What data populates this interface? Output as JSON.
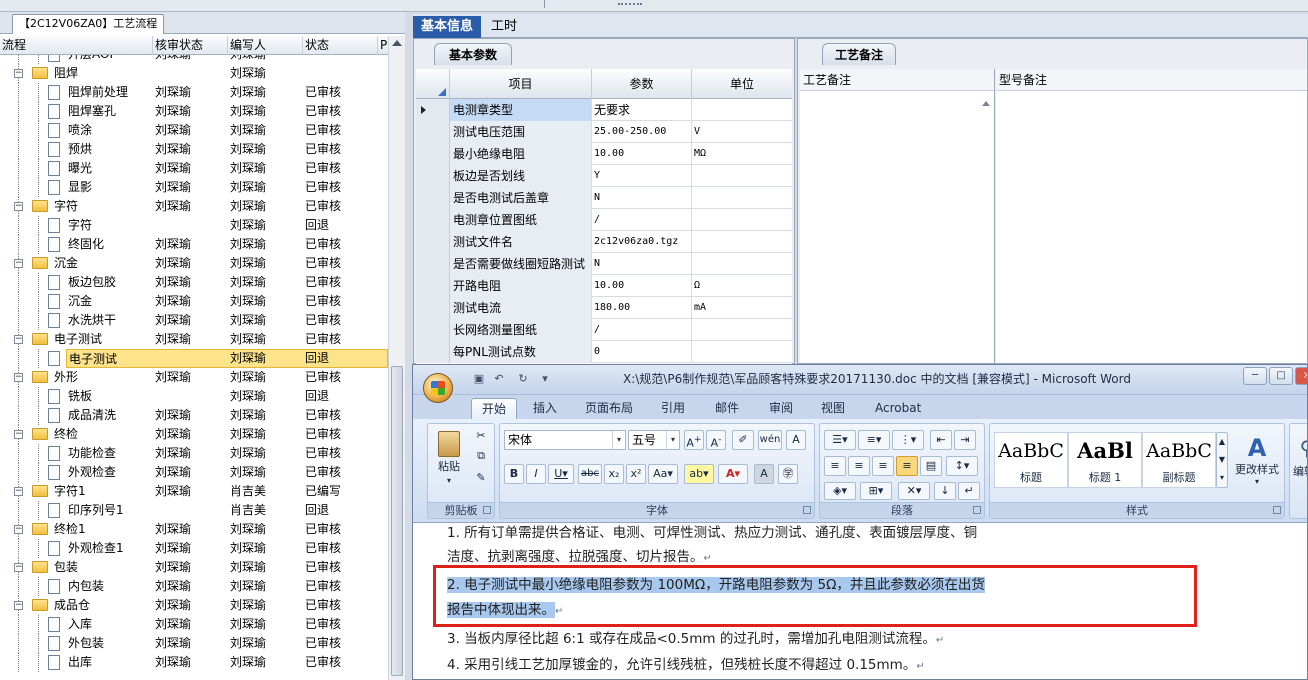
{
  "left_panel": {
    "tab": "【2C12V06ZA0】工艺流程",
    "columns": [
      "流程",
      "核审状态",
      "编写人",
      "状态",
      "P"
    ],
    "rows": [
      {
        "level": 2,
        "type": "doc",
        "name": "开层AOI",
        "c1": "刘琛瑜",
        "c2": "刘琛瑜",
        "c3": ""
      },
      {
        "level": 1,
        "type": "folder",
        "name": "阻焊",
        "c1": "",
        "c2": "刘琛瑜",
        "c3": ""
      },
      {
        "level": 2,
        "type": "doc",
        "name": "阻焊前处理",
        "c1": "刘琛瑜",
        "c2": "刘琛瑜",
        "c3": "已审核"
      },
      {
        "level": 2,
        "type": "doc",
        "name": "阻焊塞孔",
        "c1": "刘琛瑜",
        "c2": "刘琛瑜",
        "c3": "已审核"
      },
      {
        "level": 2,
        "type": "doc",
        "name": "喷涂",
        "c1": "刘琛瑜",
        "c2": "刘琛瑜",
        "c3": "已审核"
      },
      {
        "level": 2,
        "type": "doc",
        "name": "预烘",
        "c1": "刘琛瑜",
        "c2": "刘琛瑜",
        "c3": "已审核"
      },
      {
        "level": 2,
        "type": "doc",
        "name": "曝光",
        "c1": "刘琛瑜",
        "c2": "刘琛瑜",
        "c3": "已审核"
      },
      {
        "level": 2,
        "type": "doc",
        "name": "显影",
        "c1": "刘琛瑜",
        "c2": "刘琛瑜",
        "c3": "已审核"
      },
      {
        "level": 1,
        "type": "folder",
        "name": "字符",
        "c1": "刘琛瑜",
        "c2": "刘琛瑜",
        "c3": "已审核"
      },
      {
        "level": 2,
        "type": "doc",
        "name": "字符",
        "c1": "",
        "c2": "刘琛瑜",
        "c3": "回退"
      },
      {
        "level": 2,
        "type": "doc",
        "name": "终固化",
        "c1": "刘琛瑜",
        "c2": "刘琛瑜",
        "c3": "已审核"
      },
      {
        "level": 1,
        "type": "folder",
        "name": "沉金",
        "c1": "刘琛瑜",
        "c2": "刘琛瑜",
        "c3": "已审核"
      },
      {
        "level": 2,
        "type": "doc",
        "name": "板边包胶",
        "c1": "刘琛瑜",
        "c2": "刘琛瑜",
        "c3": "已审核"
      },
      {
        "level": 2,
        "type": "doc",
        "name": "沉金",
        "c1": "刘琛瑜",
        "c2": "刘琛瑜",
        "c3": "已审核"
      },
      {
        "level": 2,
        "type": "doc",
        "name": "水洗烘干",
        "c1": "刘琛瑜",
        "c2": "刘琛瑜",
        "c3": "已审核"
      },
      {
        "level": 1,
        "type": "folder",
        "name": "电子测试",
        "c1": "刘琛瑜",
        "c2": "刘琛瑜",
        "c3": "已审核"
      },
      {
        "level": 2,
        "type": "doc",
        "name": "电子测试",
        "c1": "",
        "c2": "刘琛瑜",
        "c3": "回退",
        "selected": true
      },
      {
        "level": 1,
        "type": "folder",
        "name": "外形",
        "c1": "刘琛瑜",
        "c2": "刘琛瑜",
        "c3": "已审核"
      },
      {
        "level": 2,
        "type": "doc",
        "name": "铣板",
        "c1": "",
        "c2": "刘琛瑜",
        "c3": "回退"
      },
      {
        "level": 2,
        "type": "doc",
        "name": "成品清洗",
        "c1": "刘琛瑜",
        "c2": "刘琛瑜",
        "c3": "已审核"
      },
      {
        "level": 1,
        "type": "folder",
        "name": "终检",
        "c1": "刘琛瑜",
        "c2": "刘琛瑜",
        "c3": "已审核"
      },
      {
        "level": 2,
        "type": "doc",
        "name": "功能检查",
        "c1": "刘琛瑜",
        "c2": "刘琛瑜",
        "c3": "已审核"
      },
      {
        "level": 2,
        "type": "doc",
        "name": "外观检查",
        "c1": "刘琛瑜",
        "c2": "刘琛瑜",
        "c3": "已审核"
      },
      {
        "level": 1,
        "type": "folder",
        "name": "字符1",
        "c1": "刘琛瑜",
        "c2": "肖吉美",
        "c3": "已编写"
      },
      {
        "level": 2,
        "type": "doc",
        "name": "印序列号1",
        "c1": "",
        "c2": "肖吉美",
        "c3": "回退"
      },
      {
        "level": 1,
        "type": "folder",
        "name": "终检1",
        "c1": "刘琛瑜",
        "c2": "刘琛瑜",
        "c3": "已审核"
      },
      {
        "level": 2,
        "type": "doc",
        "name": "外观检查1",
        "c1": "刘琛瑜",
        "c2": "刘琛瑜",
        "c3": "已审核"
      },
      {
        "level": 1,
        "type": "folder",
        "name": "包装",
        "c1": "刘琛瑜",
        "c2": "刘琛瑜",
        "c3": "已审核"
      },
      {
        "level": 2,
        "type": "doc",
        "name": "内包装",
        "c1": "刘琛瑜",
        "c2": "刘琛瑜",
        "c3": "已审核"
      },
      {
        "level": 1,
        "type": "folder",
        "name": "成品仓",
        "c1": "刘琛瑜",
        "c2": "刘琛瑜",
        "c3": "已审核"
      },
      {
        "level": 2,
        "type": "doc",
        "name": "入库",
        "c1": "刘琛瑜",
        "c2": "刘琛瑜",
        "c3": "已审核"
      },
      {
        "level": 2,
        "type": "doc",
        "name": "外包装",
        "c1": "刘琛瑜",
        "c2": "刘琛瑜",
        "c3": "已审核"
      },
      {
        "level": 2,
        "type": "doc",
        "name": "出库",
        "c1": "刘琛瑜",
        "c2": "刘琛瑜",
        "c3": "已审核"
      }
    ]
  },
  "main_tabs": [
    "基本信息",
    "工时"
  ],
  "basic_params": {
    "tab": "基本参数",
    "columns": [
      "项目",
      "参数",
      "单位"
    ],
    "rows": [
      {
        "item": "电测章类型",
        "param": "无要求",
        "unit": "",
        "current": true
      },
      {
        "item": "测试电压范围",
        "param": "25.00-250.00",
        "unit": "V"
      },
      {
        "item": "最小绝缘电阻",
        "param": "10.00",
        "unit": "MΩ"
      },
      {
        "item": "板边是否划线",
        "param": "Y",
        "unit": ""
      },
      {
        "item": "是否电测试后盖章",
        "param": "N",
        "unit": ""
      },
      {
        "item": "电测章位置图纸",
        "param": "/",
        "unit": ""
      },
      {
        "item": "测试文件名",
        "param": "2c12v06za0.tgz",
        "unit": ""
      },
      {
        "item": "是否需要做线圈短路测试",
        "param": "N",
        "unit": ""
      },
      {
        "item": "开路电阻",
        "param": "10.00",
        "unit": "Ω"
      },
      {
        "item": "测试电流",
        "param": "180.00",
        "unit": "mA"
      },
      {
        "item": "长网络测量图纸",
        "param": "/",
        "unit": ""
      },
      {
        "item": "每PNL测试点数",
        "param": "0",
        "unit": ""
      }
    ]
  },
  "notes": {
    "tab": "工艺备注",
    "process_note": "工艺备注",
    "model_note": "型号备注"
  },
  "word": {
    "title": "X:\\规范\\P6制作规范\\军品顾客特殊要求20171130.doc 中的文档 [兼容模式] - Microsoft Word",
    "tabs": [
      "开始",
      "插入",
      "页面布局",
      "引用",
      "邮件",
      "审阅",
      "视图",
      "Acrobat"
    ],
    "font_name": "宋体",
    "font_size": "五号",
    "paste_label": "粘贴",
    "groups": {
      "clipboard": "剪贴板",
      "font": "字体",
      "paragraph": "段落",
      "styles": "样式"
    },
    "styles": [
      {
        "sample": "AaBbC",
        "label": "标题"
      },
      {
        "sample": "AaBl",
        "label": "标题 1"
      },
      {
        "sample": "AaBbC",
        "label": "副标题"
      }
    ],
    "change_styles": "更改样式",
    "edit_label": "编辑",
    "lines": [
      "1. 所有订单需提供合格证、电测、可焊性测试、热应力测试、通孔度、表面镀层厚度、铜",
      "洁度、抗剥离强度、拉脱强度、切片报告。",
      "2. 电子测试中最小绝缘电阻参数为 100MΩ，开路电阻参数为 5Ω，并且此参数必须在出货",
      "报告中体现出来。",
      "3. 当板内厚径比超 6:1 或存在成品<0.5mm 的过孔时，需增加孔电阻测试流程。",
      "4. 采用引线工艺加厚镀金的，允许引线残桩，但残桩长度不得超过 0.15mm。"
    ]
  }
}
